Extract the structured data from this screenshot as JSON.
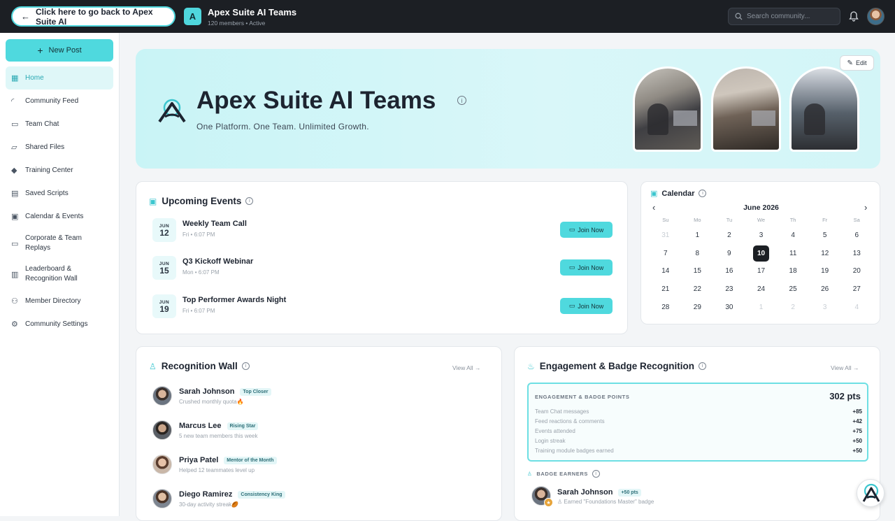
{
  "topbar": {
    "back_label": "Click here to go back to Apex Suite AI",
    "badge_letter": "A",
    "community_name": "Apex Suite AI Teams",
    "community_meta": "120 members • Active",
    "search_placeholder": "Search community..."
  },
  "sidebar": {
    "new_post": "New Post",
    "items": [
      {
        "label": "Home",
        "icon": "grid-icon"
      },
      {
        "label": "Community Feed",
        "icon": "rss-icon"
      },
      {
        "label": "Team Chat",
        "icon": "chat-icon"
      },
      {
        "label": "Shared Files",
        "icon": "folder-icon"
      },
      {
        "label": "Training Center",
        "icon": "graduation-cap-icon"
      },
      {
        "label": "Saved Scripts",
        "icon": "message-square-icon"
      },
      {
        "label": "Calendar & Events",
        "icon": "calendar-icon"
      },
      {
        "label": "Corporate & Team Replays",
        "icon": "video-icon"
      },
      {
        "label": "Leaderboard & Recognition Wall",
        "icon": "bar-chart-icon"
      },
      {
        "label": "Member Directory",
        "icon": "users-icon"
      },
      {
        "label": "Community Settings",
        "icon": "gear-icon"
      }
    ]
  },
  "hero": {
    "title": "Apex Suite AI Teams",
    "subtitle": "One Platform. One Team. Unlimited Growth.",
    "edit_label": "Edit"
  },
  "events": {
    "title": "Upcoming Events",
    "join_label": "Join Now",
    "items": [
      {
        "month": "JUN",
        "day": "12",
        "title": "Weekly Team Call",
        "time": "Fri • 6:07 PM"
      },
      {
        "month": "JUN",
        "day": "15",
        "title": "Q3 Kickoff Webinar",
        "time": "Mon • 6:07 PM"
      },
      {
        "month": "JUN",
        "day": "19",
        "title": "Top Performer Awards Night",
        "time": "Fri • 6:07 PM"
      }
    ]
  },
  "calendar": {
    "title": "Calendar",
    "month_label": "June 2026",
    "dow": [
      "Su",
      "Mo",
      "Tu",
      "We",
      "Th",
      "Fr",
      "Sa"
    ],
    "weeks": [
      [
        "31",
        "1",
        "2",
        "3",
        "4",
        "5",
        "6"
      ],
      [
        "7",
        "8",
        "9",
        "10",
        "11",
        "12",
        "13"
      ],
      [
        "14",
        "15",
        "16",
        "17",
        "18",
        "19",
        "20"
      ],
      [
        "21",
        "22",
        "23",
        "24",
        "25",
        "26",
        "27"
      ],
      [
        "28",
        "29",
        "30",
        "1",
        "2",
        "3",
        "4"
      ]
    ],
    "selected": "10"
  },
  "recognition": {
    "title": "Recognition Wall",
    "view_all": "View All",
    "items": [
      {
        "name": "Sarah Johnson",
        "tag": "Top Closer",
        "note": "Crushed monthly quota🔥"
      },
      {
        "name": "Marcus Lee",
        "tag": "Rising Star",
        "note": "5 new team members this week"
      },
      {
        "name": "Priya Patel",
        "tag": "Mentor of the Month",
        "note": "Helped 12 teammates level up"
      },
      {
        "name": "Diego Ramirez",
        "tag": "Consistency King",
        "note": "30-day activity streak🏉"
      }
    ]
  },
  "engagement": {
    "title": "Engagement & Badge Recognition",
    "view_all": "View All",
    "points_heading": "ENGAGEMENT & BADGE POINTS",
    "points_total": "302 pts",
    "rows": [
      {
        "label": "Team Chat messages",
        "value": "+85"
      },
      {
        "label": "Feed reactions & comments",
        "value": "+42"
      },
      {
        "label": "Events attended",
        "value": "+75"
      },
      {
        "label": "Login streak",
        "value": "+50"
      },
      {
        "label": "Training module badges earned",
        "value": "+50"
      }
    ],
    "earners_heading": "BADGE EARNERS",
    "earner": {
      "name": "Sarah Johnson",
      "tag": "+50 pts",
      "note": "Earned \"Foundations Master\" badge"
    }
  },
  "colors": {
    "accent": "#4fd9de",
    "dark": "#1c1f24",
    "hero_bg": "#d3f5f7"
  }
}
